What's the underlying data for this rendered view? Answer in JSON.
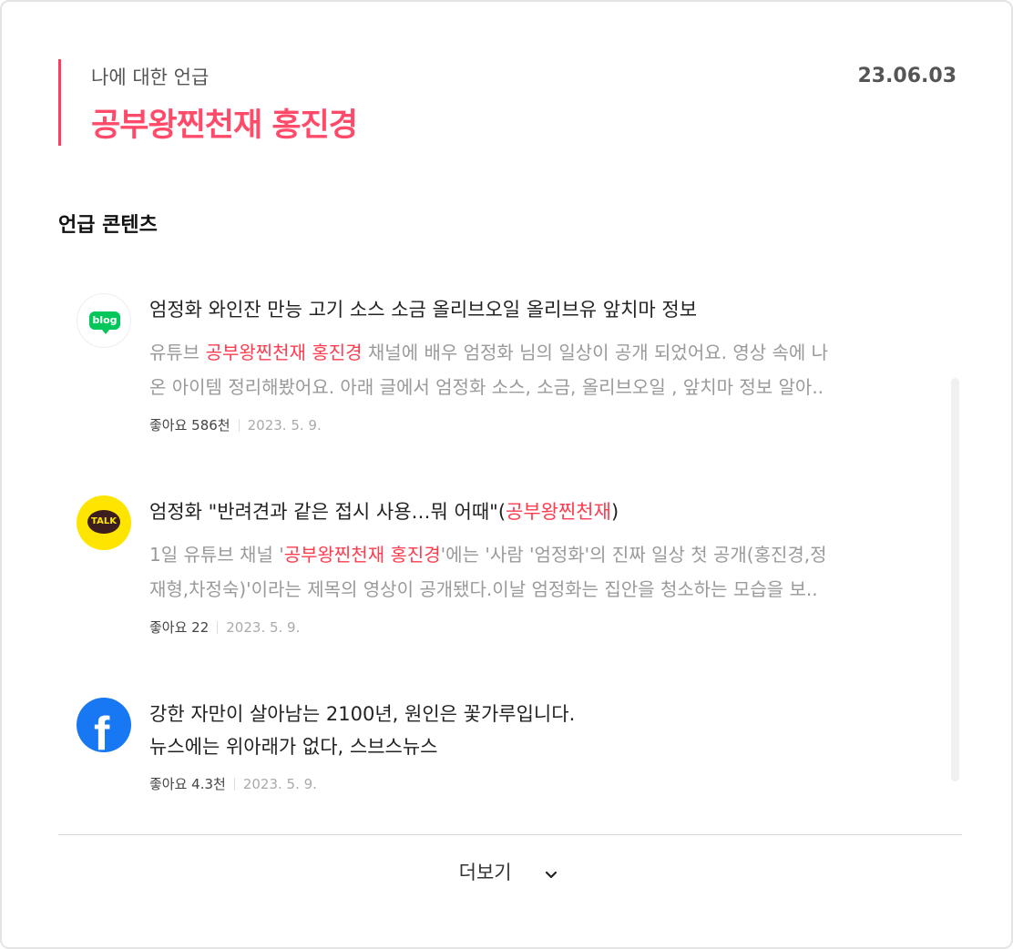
{
  "header": {
    "subtitle": "나에 대한 언급",
    "title": "공부왕찐천재 홍진경",
    "date": "23.06.03"
  },
  "section_title": "언급 콘텐츠",
  "items": [
    {
      "source_icon": "blog-icon",
      "title": "엄정화 와인잔 만능 고기 소스 소금 올리브오일 올리브유 앞치마 정보",
      "desc_line1_pre": "유튜브 ",
      "desc_line1_hl": "공부왕찐천재 홍진경",
      "desc_line1_post": " 채널에 배우 엄정화 님의 일상이 공개 되었어요. 영상 속에 나",
      "desc_line2": "온 아이템 정리해봤어요. 아래 글에서 엄정화 소스, 소금, 올리브오일 , 앞치마 정보 알아..",
      "likes": "좋아요 586천",
      "date": "2023. 5. 9."
    },
    {
      "source_icon": "kakaotalk-icon",
      "title_pre": "엄정화 \"반려견과 같은 접시 사용…뭐 어때\"(",
      "title_hl": "공부왕찐천재",
      "title_post": ")",
      "desc_line1_pre": "1일 유튜브 채널 '",
      "desc_line1_hl": "공부왕찐천재 홍진경",
      "desc_line1_post": "'에는 '사람 '엄정화'의 진짜 일상 첫 공개(홍진경,정",
      "desc_line2": "재형,차정숙)'이라는 제목의 영상이 공개됐다.이날 엄정화는 집안을 청소하는 모습을 보..",
      "likes": "좋아요 22",
      "date": "2023. 5. 9."
    },
    {
      "source_icon": "facebook-icon",
      "title_line1": "강한 자만이 살아남는 2100년, 원인은 꽃가루입니다.",
      "title_line2": "뉴스에는 위아래가 없다, 스브스뉴스",
      "likes": "좋아요 4.3천",
      "date": "2023. 5. 9."
    }
  ],
  "icons": {
    "blog": "blog",
    "talk": "TALK",
    "fb": "f"
  },
  "more": {
    "label": "더보기"
  },
  "colors": {
    "accent": "#ff4a6a",
    "highlight": "#ff3b4e",
    "blog_green": "#03c75a",
    "kakao_yellow": "#fee500",
    "facebook_blue": "#1877f2"
  }
}
